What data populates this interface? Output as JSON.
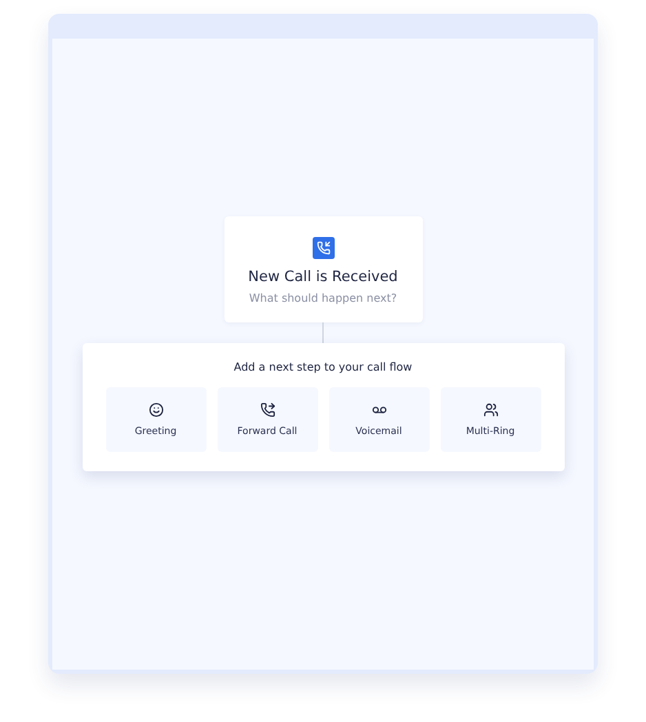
{
  "trigger": {
    "title": "New Call is Received",
    "subtitle": "What should happen next?"
  },
  "steps_panel": {
    "heading": "Add a next step to your call flow",
    "options": [
      {
        "kind": "greeting",
        "label": "Greeting"
      },
      {
        "kind": "forward",
        "label": "Forward Call"
      },
      {
        "kind": "voicemail",
        "label": "Voicemail"
      },
      {
        "kind": "multiring",
        "label": "Multi-Ring"
      }
    ]
  }
}
